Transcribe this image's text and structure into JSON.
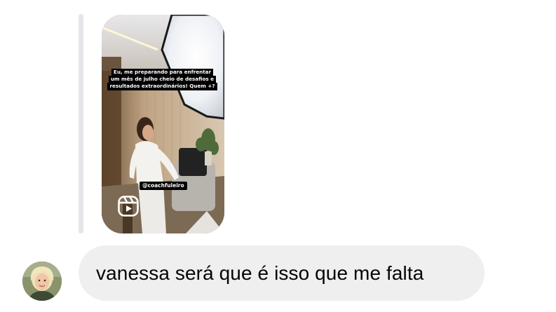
{
  "shared_reel": {
    "caption_lines": [
      "Eu, me preparando para enfrentar",
      "um mês de julho cheio de desafios e",
      "resultados extraordinários! Quem +?"
    ],
    "handle": "@coachfuleiro",
    "type_icon": "reels-icon"
  },
  "message": {
    "text": "vanessa será que é isso que me falta"
  },
  "sender": {
    "avatar": "avatar"
  },
  "colors": {
    "bubble_bg": "#efefef",
    "reply_bar": "#e4e6ea",
    "text": "#050505",
    "background": "#ffffff"
  }
}
